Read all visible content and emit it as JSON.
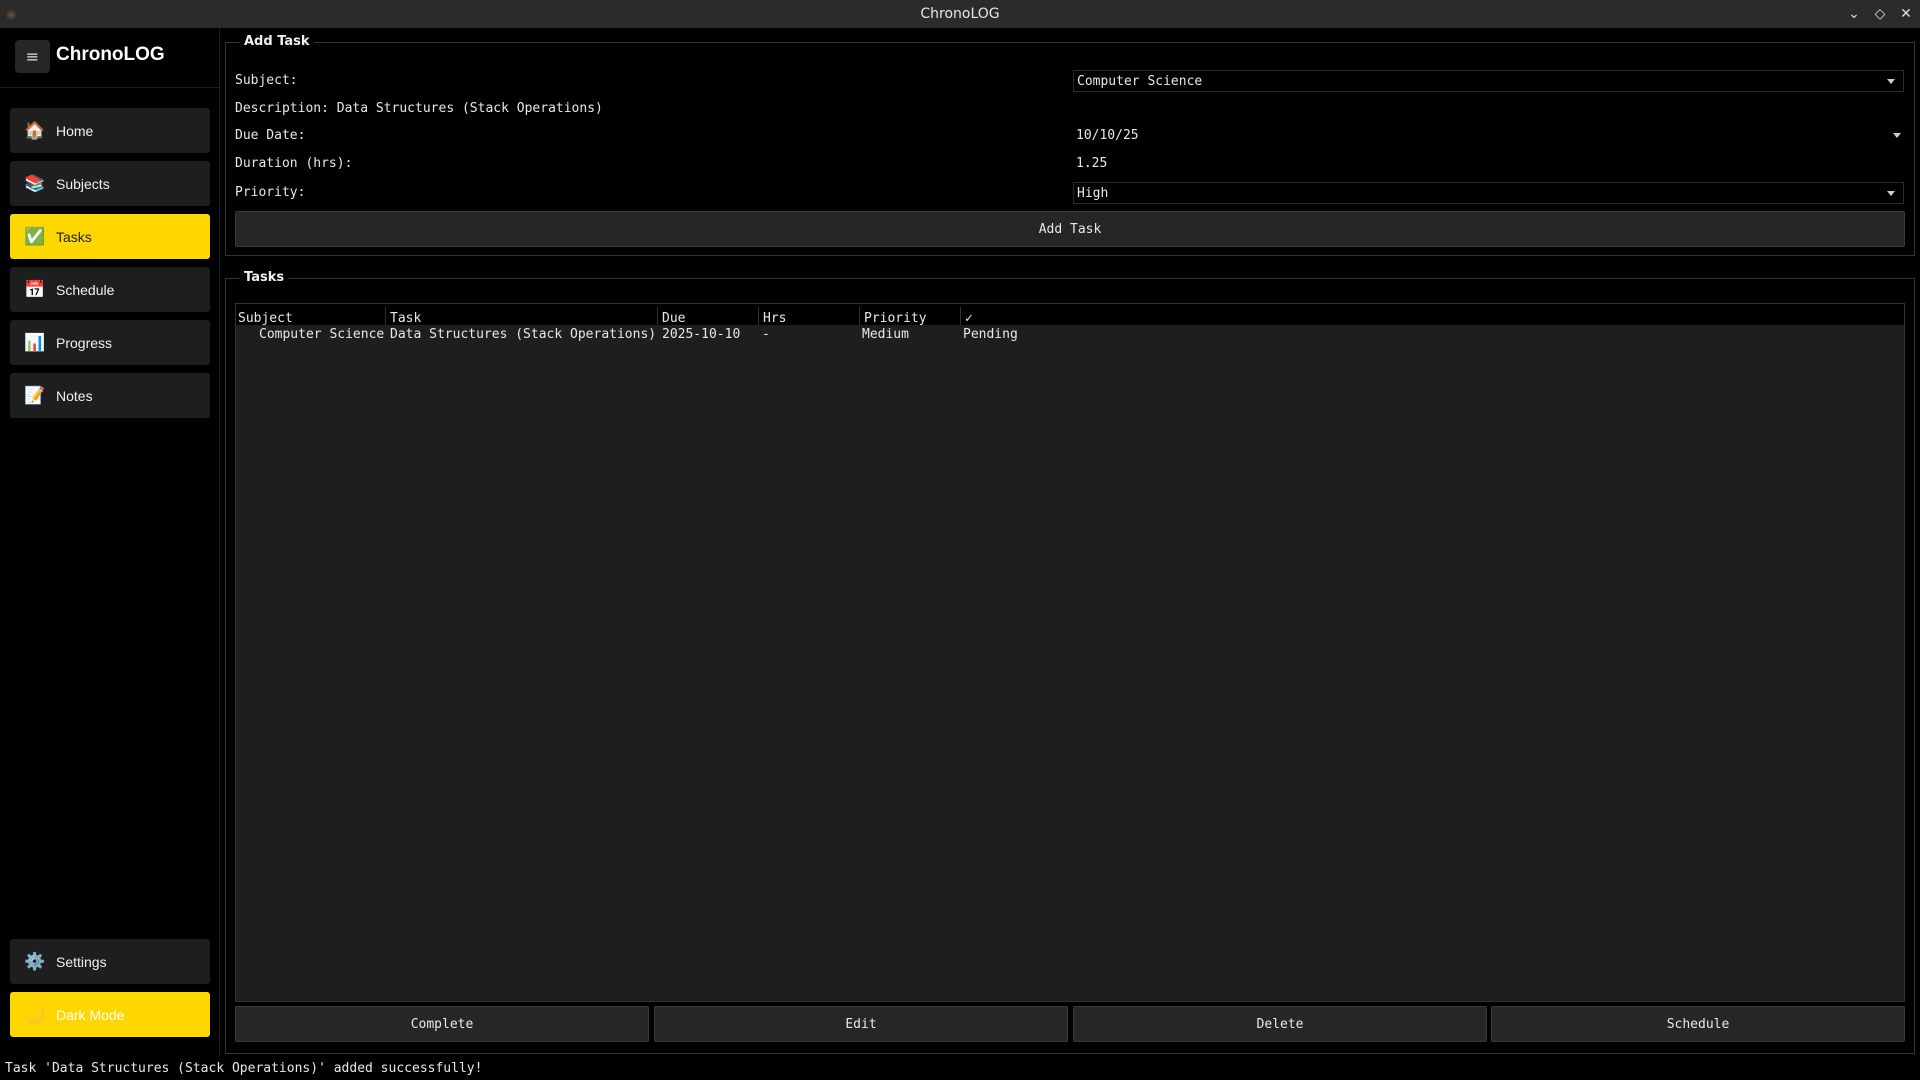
{
  "window": {
    "title": "ChronoLOG"
  },
  "sidebar": {
    "brand": "ChronoLOG",
    "items": [
      {
        "id": "home",
        "label": "Home",
        "icon": "🏠",
        "icon_name": "home-icon"
      },
      {
        "id": "subjects",
        "label": "Subjects",
        "icon": "📚",
        "icon_name": "books-icon"
      },
      {
        "id": "tasks",
        "label": "Tasks",
        "icon": "✅",
        "icon_name": "check-icon",
        "active": true
      },
      {
        "id": "schedule",
        "label": "Schedule",
        "icon": "📅",
        "icon_name": "calendar-icon"
      },
      {
        "id": "progress",
        "label": "Progress",
        "icon": "📊",
        "icon_name": "chart-icon"
      },
      {
        "id": "notes",
        "label": "Notes",
        "icon": "📝",
        "icon_name": "memo-icon"
      }
    ],
    "settings": {
      "label": "Settings",
      "icon": "⚙️"
    },
    "dark_mode": {
      "label": "Dark Mode",
      "icon": "🌙"
    }
  },
  "add_task": {
    "title": "Add Task",
    "subject_label": "Subject:",
    "subject_value": "Computer Science",
    "description_label": "Description: Data Structures (Stack Operations)",
    "due_label": "Due Date:",
    "due_value": "10/10/25",
    "duration_label": "Duration (hrs):",
    "duration_value": "1.25",
    "priority_label": "Priority:",
    "priority_value": "High",
    "button": "Add Task"
  },
  "tasks": {
    "title": "Tasks",
    "columns": [
      "Subject",
      "Task",
      "Due",
      "Hrs",
      "Priority",
      "✓"
    ],
    "rows": [
      {
        "subject": "Computer Science",
        "task": "Data Structures (Stack Operations)",
        "due": "2025-10-10",
        "hrs": "-",
        "priority": "Medium",
        "status": "Pending"
      }
    ],
    "actions": {
      "complete": "Complete",
      "edit": "Edit",
      "delete": "Delete",
      "schedule": "Schedule"
    }
  },
  "status": {
    "message": "Task 'Data Structures (Stack Operations)' added successfully!"
  },
  "colors": {
    "accent": "#ffd700",
    "background": "#000000",
    "panel": "#1e1e1e"
  }
}
